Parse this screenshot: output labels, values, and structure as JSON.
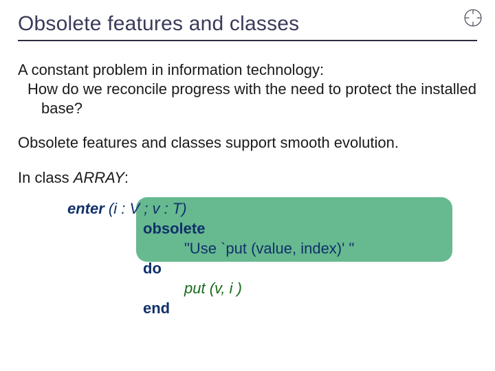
{
  "title": "Obsolete features and classes",
  "intro": "A constant problem in information technology:",
  "question": "How do we reconcile progress with the need to protect the installed base?",
  "smooth": "Obsolete features and classes support smooth evolution.",
  "classline_prefix": "In class ",
  "classline_name": "ARRAY",
  "classline_suffix": ":",
  "code": {
    "sig_name": "enter",
    "sig_args": " (i : V ; v : T)",
    "kw_obsolete": "obsolete",
    "obsolete_msg": "\"Use `put (value, index)' \"",
    "kw_do": "do",
    "call_name": "put",
    "call_args": " (v, i )",
    "kw_end": "end"
  }
}
